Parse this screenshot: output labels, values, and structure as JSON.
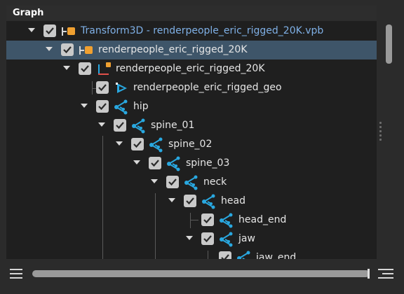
{
  "panel": {
    "title": "Graph"
  },
  "tree": [
    {
      "label": "Transform3D - renderpeople_eric_rigged_20K.vpb",
      "icon": "transform-icon",
      "checked": true,
      "expanded": true,
      "selected": false,
      "color": "#7fb0e6"
    },
    {
      "label": "renderpeople_eric_rigged_20K",
      "icon": "transform-icon",
      "checked": true,
      "expanded": true,
      "selected": true
    },
    {
      "label": "renderpeople_eric_rigged_20K",
      "icon": "axes-icon",
      "checked": true,
      "expanded": true,
      "selected": false
    },
    {
      "label": "renderpeople_eric_rigged_geo",
      "icon": "geometry-icon",
      "checked": true,
      "expanded": false,
      "selected": false
    },
    {
      "label": "hip",
      "icon": "joint-icon",
      "checked": true,
      "expanded": true,
      "selected": false
    },
    {
      "label": "spine_01",
      "icon": "joint-icon",
      "checked": true,
      "expanded": true,
      "selected": false
    },
    {
      "label": "spine_02",
      "icon": "joint-icon",
      "checked": true,
      "expanded": true,
      "selected": false
    },
    {
      "label": "spine_03",
      "icon": "joint-icon",
      "checked": true,
      "expanded": true,
      "selected": false
    },
    {
      "label": "neck",
      "icon": "joint-icon",
      "checked": true,
      "expanded": true,
      "selected": false
    },
    {
      "label": "head",
      "icon": "joint-icon",
      "checked": true,
      "expanded": true,
      "selected": false
    },
    {
      "label": "head_end",
      "icon": "joint-icon",
      "checked": true,
      "expanded": false,
      "selected": false
    },
    {
      "label": "jaw",
      "icon": "joint-icon",
      "checked": true,
      "expanded": true,
      "selected": false
    },
    {
      "label": "jaw_end",
      "icon": "joint-icon",
      "checked": true,
      "expanded": false,
      "selected": false
    }
  ],
  "toolbar": {
    "menu_icon": "hamburger-icon",
    "list_icon": "list-align-icon"
  },
  "colors": {
    "accent_blue": "#29a8e0",
    "orange": "#f0a030",
    "selection": "#3e5569"
  }
}
